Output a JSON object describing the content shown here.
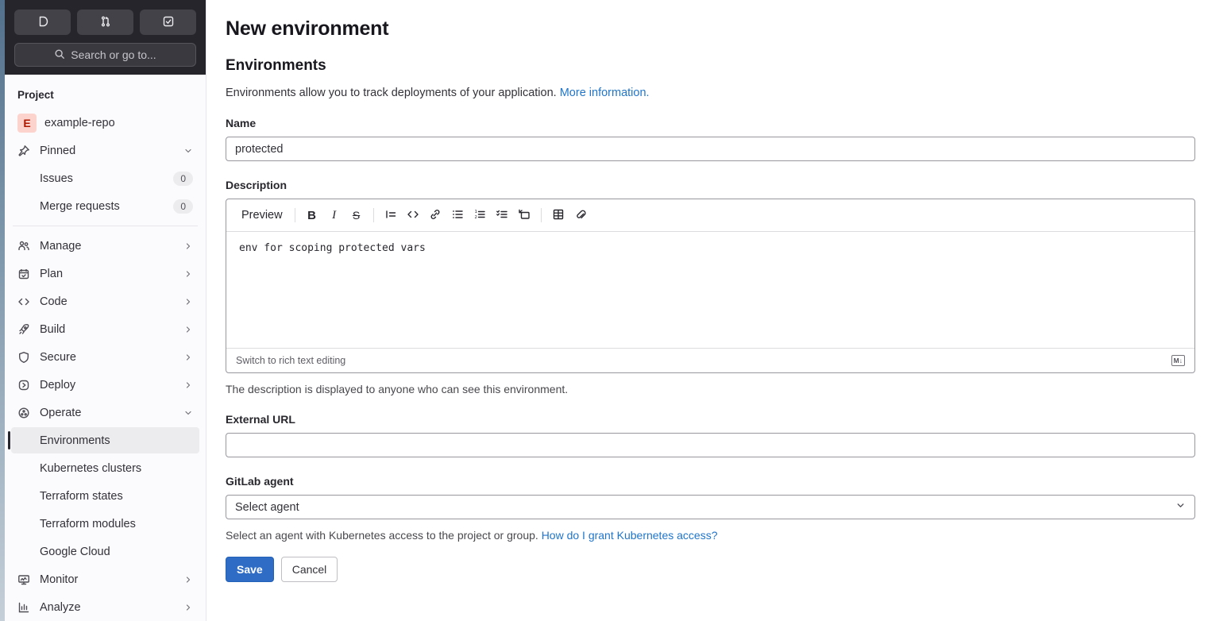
{
  "topbar": {
    "search_label": "Search or go to..."
  },
  "sidebar": {
    "section_label": "Project",
    "project": {
      "avatar_letter": "E",
      "name": "example-repo"
    },
    "pinned": {
      "label": "Pinned",
      "items": [
        {
          "label": "Issues",
          "count": "0"
        },
        {
          "label": "Merge requests",
          "count": "0"
        }
      ]
    },
    "nav": [
      {
        "label": "Manage"
      },
      {
        "label": "Plan"
      },
      {
        "label": "Code"
      },
      {
        "label": "Build"
      },
      {
        "label": "Secure"
      },
      {
        "label": "Deploy"
      },
      {
        "label": "Operate"
      }
    ],
    "operate_children": [
      {
        "label": "Environments",
        "active": true
      },
      {
        "label": "Kubernetes clusters"
      },
      {
        "label": "Terraform states"
      },
      {
        "label": "Terraform modules"
      },
      {
        "label": "Google Cloud"
      }
    ],
    "nav_bottom": [
      {
        "label": "Monitor"
      },
      {
        "label": "Analyze"
      }
    ]
  },
  "main": {
    "page_title": "New environment",
    "section_title": "Environments",
    "intro_text": "Environments allow you to track deployments of your application.",
    "intro_link": "More information.",
    "name_field": {
      "label": "Name",
      "value": "protected"
    },
    "description": {
      "label": "Description",
      "preview_label": "Preview",
      "value": "env for scoping protected vars",
      "switch_link": "Switch to rich text editing",
      "markdown_badge": "M↓",
      "help": "The description is displayed to anyone who can see this environment."
    },
    "external_url": {
      "label": "External URL",
      "value": ""
    },
    "agent": {
      "label": "GitLab agent",
      "selected": "Select agent",
      "help": "Select an agent with Kubernetes access to the project or group.",
      "help_link": "How do I grant Kubernetes access?"
    },
    "buttons": {
      "save": "Save",
      "cancel": "Cancel"
    }
  },
  "icons": {
    "topbar": [
      "issues-icon",
      "merge-request-icon",
      "todo-icon",
      "search-icon"
    ],
    "sidebar": [
      "pin-icon",
      "users-icon",
      "calendar-icon",
      "code-icon",
      "rocket-icon",
      "shield-icon",
      "deploy-icon",
      "cloud-pod-icon",
      "monitor-icon",
      "chart-icon",
      "chevron-right-icon",
      "chevron-down-icon"
    ],
    "editor": [
      "bold-icon",
      "italic-icon",
      "strikethrough-icon",
      "quote-icon",
      "code-icon",
      "link-icon",
      "bullet-list-icon",
      "numbered-list-icon",
      "task-list-icon",
      "collapsible-section-icon",
      "table-icon",
      "attach-file-icon",
      "markdown-icon"
    ]
  },
  "colors": {
    "accent_blue": "#2e6cc6",
    "link_blue": "#1f75cb",
    "sidebar_bg": "#fbfafd",
    "dark_header_bg": "#26252b",
    "active_item_bg": "#ececef"
  }
}
